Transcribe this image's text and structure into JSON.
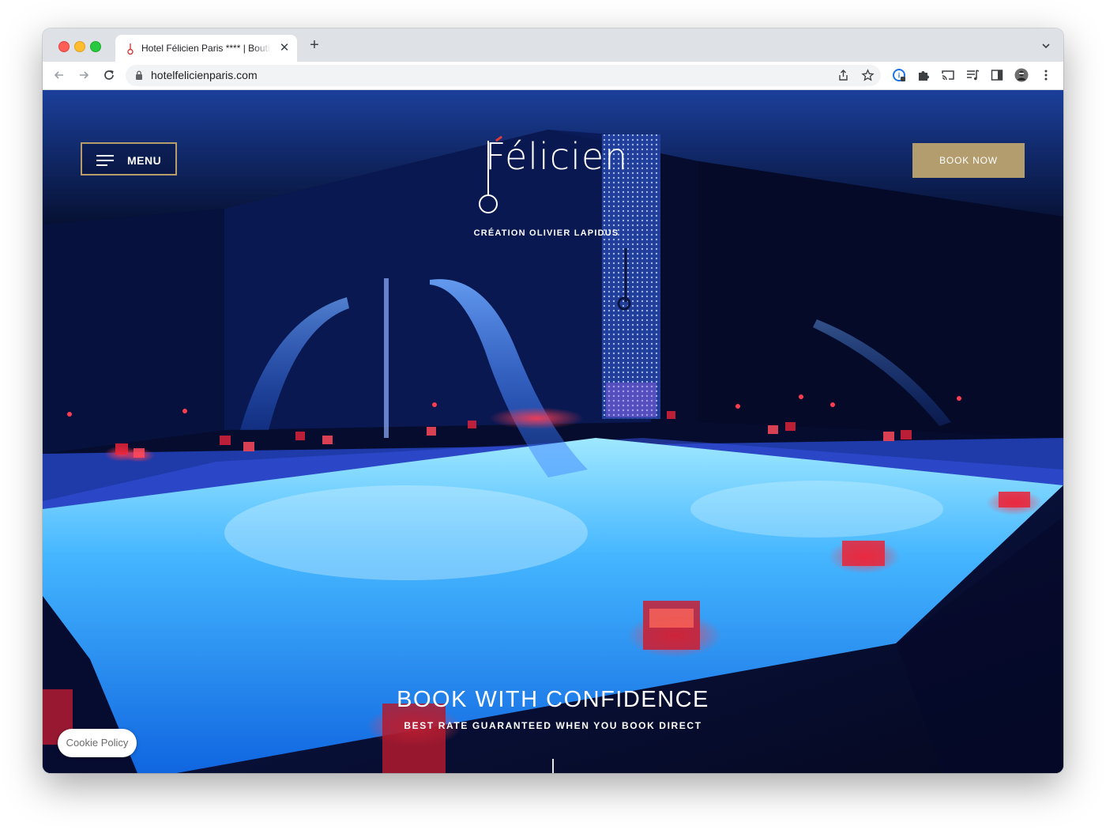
{
  "browser": {
    "tab": {
      "title": "Hotel Félicien Paris **** | Boutique Hotel",
      "close_icon": "close-icon",
      "favicon": "felicien-favicon"
    },
    "new_tab_label": "+",
    "address_bar": {
      "url": "hotelfelicienparis.com",
      "secure_icon": "lock-icon"
    },
    "icons": [
      "back-icon",
      "forward-icon",
      "reload-icon",
      "share-icon",
      "bookmark-star-icon",
      "extension-badge-icon",
      "puzzle-icon",
      "cast-icon",
      "reading-list-icon",
      "side-panel-icon",
      "profile-avatar",
      "more-menu-icon"
    ]
  },
  "site": {
    "menu_label": "MENU",
    "book_label": "BOOK NOW",
    "logo_text": "Félicien",
    "tagline": "CRÉATION OLIVIER LAPIDUS",
    "hero_title": "BOOK WITH CONFIDENCE",
    "hero_subtitle": "BEST RATE GUARANTEED WHEN YOU BOOK DIRECT",
    "cookie_label": "Cookie Policy",
    "colors": {
      "gold": "#b39c6d",
      "menu_border": "#b89d6a",
      "pool_blue": "#3aa9ff",
      "night_navy": "#061038",
      "candle_red": "#e8243a"
    }
  }
}
